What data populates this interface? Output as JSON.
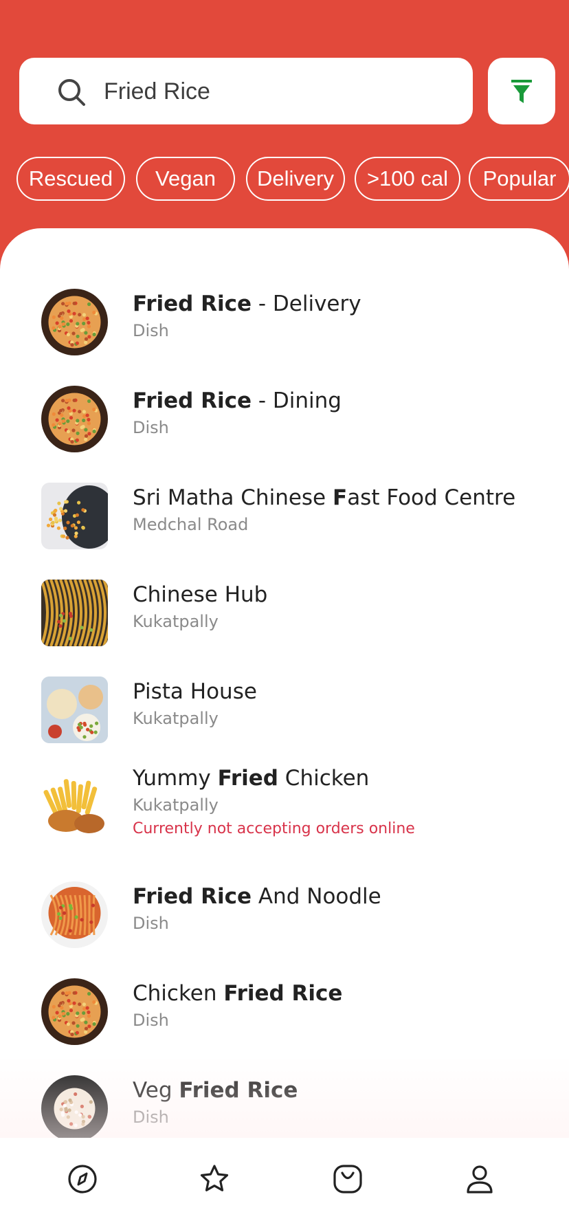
{
  "search": {
    "query": "Fried Rice"
  },
  "icons": {
    "search": "search-icon",
    "filter": "filter-icon"
  },
  "colors": {
    "brand": "#e2493b",
    "filter_icon": "#1a9a3a",
    "warning": "#d8334a"
  },
  "chips": [
    "Rescued",
    "Vegan",
    "Delivery",
    ">100 cal",
    "Popular"
  ],
  "results": [
    {
      "title_parts": [
        {
          "t": "Fried Rice",
          "b": true
        },
        {
          "t": " - Delivery",
          "b": false
        }
      ],
      "subtitle": "Dish",
      "thumb": "fried-rice-bowl"
    },
    {
      "title_parts": [
        {
          "t": "Fried Rice",
          "b": true
        },
        {
          "t": " - Dining",
          "b": false
        }
      ],
      "subtitle": "Dish",
      "thumb": "fried-rice-bowl"
    },
    {
      "title_parts": [
        {
          "t": "Sri Matha Chinese ",
          "b": false
        },
        {
          "t": "F",
          "b": true
        },
        {
          "t": "ast Food Centre",
          "b": false
        }
      ],
      "subtitle": "Medchal Road",
      "thumb": "chinese-plate"
    },
    {
      "title_parts": [
        {
          "t": "Chinese Hub",
          "b": false
        }
      ],
      "subtitle": "Kukatpally",
      "thumb": "noodles"
    },
    {
      "title_parts": [
        {
          "t": "Pista House",
          "b": false
        }
      ],
      "subtitle": "Kukatpally",
      "thumb": "table-spread"
    },
    {
      "title_parts": [
        {
          "t": "Yummy ",
          "b": false
        },
        {
          "t": "Fried",
          "b": true
        },
        {
          "t": " Chicken",
          "b": false
        }
      ],
      "subtitle": "Kukatpally",
      "warning": "Currently not accepting orders online",
      "thumb": "fried-chicken"
    },
    {
      "title_parts": [
        {
          "t": "Fried Rice",
          "b": true
        },
        {
          "t": " And Noodle",
          "b": false
        }
      ],
      "subtitle": "Dish",
      "thumb": "noodle-bowl"
    },
    {
      "title_parts": [
        {
          "t": "Chicken ",
          "b": false
        },
        {
          "t": "Fried Rice",
          "b": true
        }
      ],
      "subtitle": "Dish",
      "thumb": "fried-rice-bowl"
    },
    {
      "title_parts": [
        {
          "t": "Veg ",
          "b": false
        },
        {
          "t": "Fried Rice",
          "b": true
        }
      ],
      "subtitle": "Dish",
      "thumb": "veg-rice-bowl"
    }
  ],
  "nav": [
    {
      "icon": "compass-icon",
      "active": true
    },
    {
      "icon": "star-icon",
      "active": false
    },
    {
      "icon": "bag-icon",
      "active": false
    },
    {
      "icon": "user-icon",
      "active": false
    }
  ]
}
